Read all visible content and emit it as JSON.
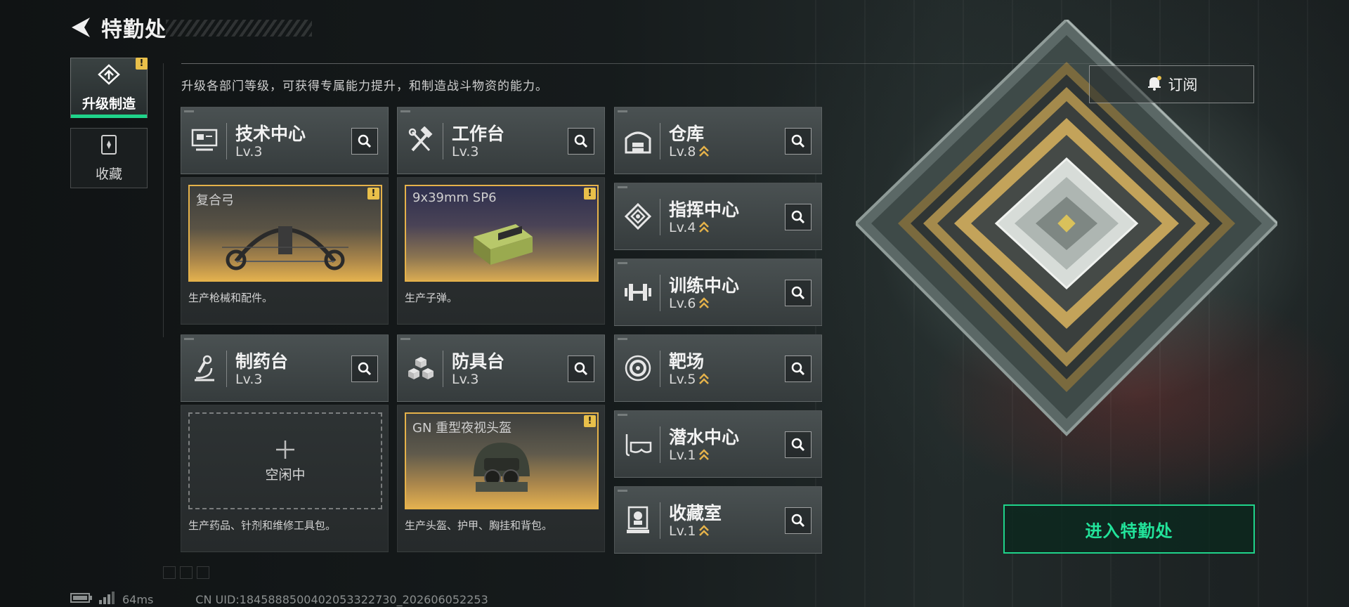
{
  "header": {
    "title": "特勤处"
  },
  "nav": {
    "items": [
      {
        "label": "升级制造",
        "alert": "!"
      },
      {
        "label": "收藏"
      }
    ]
  },
  "description": "升级各部门等级，可获得专属能力提升，和制造战斗物资的能力。",
  "subscribe": {
    "label": "订阅"
  },
  "enter": {
    "label": "进入特勤处"
  },
  "departments": {
    "tech_center": {
      "name": "技术中心",
      "level": "Lv.3",
      "product": "复合弓",
      "alert": "!",
      "desc": "生产枪械和配件。"
    },
    "workbench": {
      "name": "工作台",
      "level": "Lv.3",
      "product": "9x39mm SP6",
      "alert": "!",
      "desc": "生产子弹。"
    },
    "pharmacy": {
      "name": "制药台",
      "level": "Lv.3",
      "idle": "空闲中",
      "desc": "生产药品、针剂和维修工具包。"
    },
    "armor_bench": {
      "name": "防具台",
      "level": "Lv.3",
      "product": "GN 重型夜视头盔",
      "alert": "!",
      "desc": "生产头盔、护甲、胸挂和背包。"
    },
    "warehouse": {
      "name": "仓库",
      "level": "Lv.8"
    },
    "command_center": {
      "name": "指挥中心",
      "level": "Lv.4"
    },
    "training_center": {
      "name": "训练中心",
      "level": "Lv.6"
    },
    "shooting_range": {
      "name": "靶场",
      "level": "Lv.5"
    },
    "diving_center": {
      "name": "潜水中心",
      "level": "Lv.1"
    },
    "collection_room": {
      "name": "收藏室",
      "level": "Lv.1"
    }
  },
  "footer": {
    "ping": "64ms",
    "uid": "CN UID:1845888500402053322730_202606052253"
  },
  "colors": {
    "accent_green": "#1fd38a",
    "alert_yellow": "#e9c04a",
    "upgrade_gold": "#e5b24a"
  },
  "icons": {
    "back": "back-arrow-icon",
    "upgrade": "upgrade-craft-icon",
    "collection": "collection-icon",
    "search": "magnifier-icon",
    "subscribe": "bell-icon",
    "level_up": "double-chevron-up-icon"
  }
}
